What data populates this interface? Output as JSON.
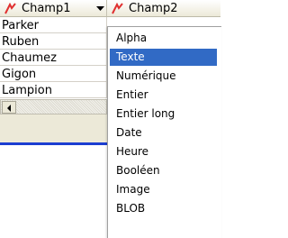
{
  "columns": [
    {
      "label": "Champ1",
      "has_dropdown": true
    },
    {
      "label": "Champ2"
    }
  ],
  "rows": [
    "Parker",
    "Ruben",
    "Chaumez",
    "Gigon",
    "Lampion"
  ],
  "type_menu": {
    "items": [
      "Alpha",
      "Texte",
      "Numérique",
      "Entier",
      "Entier long",
      "Date",
      "Heure",
      "Booléen",
      "Image",
      "BLOB"
    ],
    "selected": "Texte"
  },
  "colors": {
    "selection": "#316ac5",
    "accent_line": "#1c3ed1",
    "icon_red": "#e03030"
  },
  "icons": {
    "column_type": "red-pen-icon",
    "dropdown": "dropdown-arrow-icon",
    "scroll_left": "scroll-left-arrow-icon"
  }
}
